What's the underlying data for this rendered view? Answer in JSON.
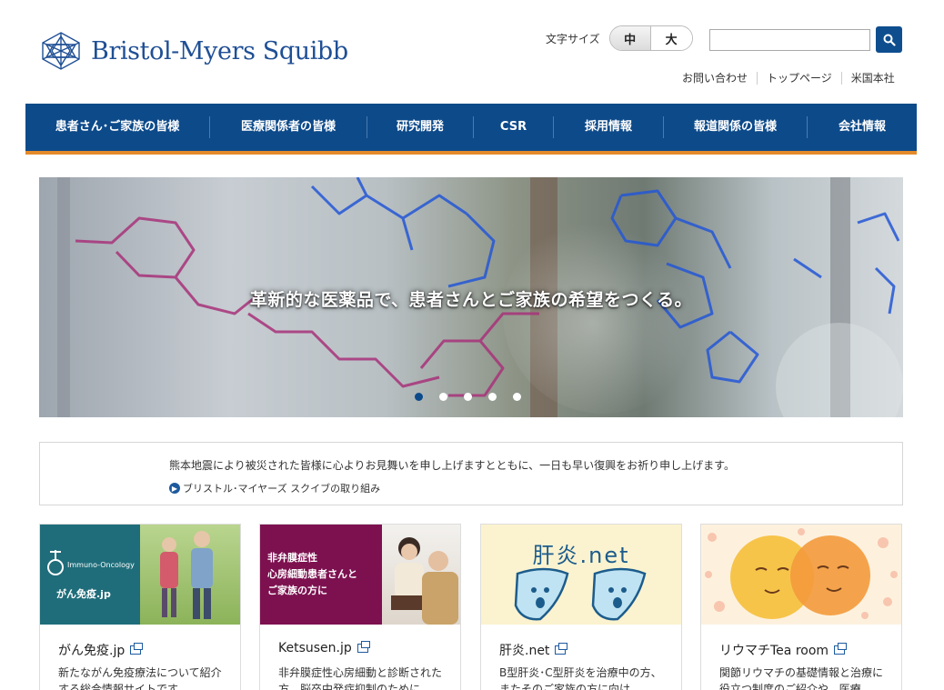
{
  "brand": {
    "name": "Bristol-Myers Squibb",
    "color": "#1f4f95"
  },
  "header": {
    "fontsize_label": "文字サイズ",
    "fontsize_options": [
      "中",
      "大"
    ],
    "fontsize_selected": "中",
    "search_placeholder": "",
    "util_links": [
      "お問い合わせ",
      "トップページ",
      "米国本社"
    ]
  },
  "nav": {
    "items": [
      "患者さん･ご家族の皆様",
      "医療関係者の皆様",
      "研究開発",
      "CSR",
      "採用情報",
      "報道関係の皆様",
      "会社情報"
    ],
    "color": "#0d4a8a",
    "accent": "#e38a2a"
  },
  "hero": {
    "caption": "革新的な医薬品で、患者さんとご家族の希望をつくる。",
    "slide_count": 5,
    "active_slide": 1
  },
  "notice": {
    "text": "熊本地震により被災された皆様に心よりお見舞いを申し上げますとともに、一日も早い復興をお祈り申し上げます。",
    "link": "ブリストル･マイヤーズ スクイブの取り組み"
  },
  "cards": [
    {
      "image_label_small": "Immuno-Oncology",
      "image_label": "がん免疫.jp",
      "title": "がん免疫.jp",
      "desc": "新たながん免疫療法について紹介する総合情報サイトです"
    },
    {
      "image_label": "非弁膜症性\n心房細動患者さんと\nご家族の方に",
      "title": "Ketsusen.jp",
      "desc": "非弁膜症性心房細動と診断された方、脳卒中発症抑制のために"
    },
    {
      "image_label": "肝炎.net",
      "title": "肝炎.net",
      "desc": "B型肝炎･C型肝炎を治療中の方、またそのご家族の方に向け"
    },
    {
      "image_label": "",
      "title": "リウマチTea room",
      "desc": "関節リウマチの基礎情報と治療に役立つ制度のご紹介や、医療"
    }
  ]
}
